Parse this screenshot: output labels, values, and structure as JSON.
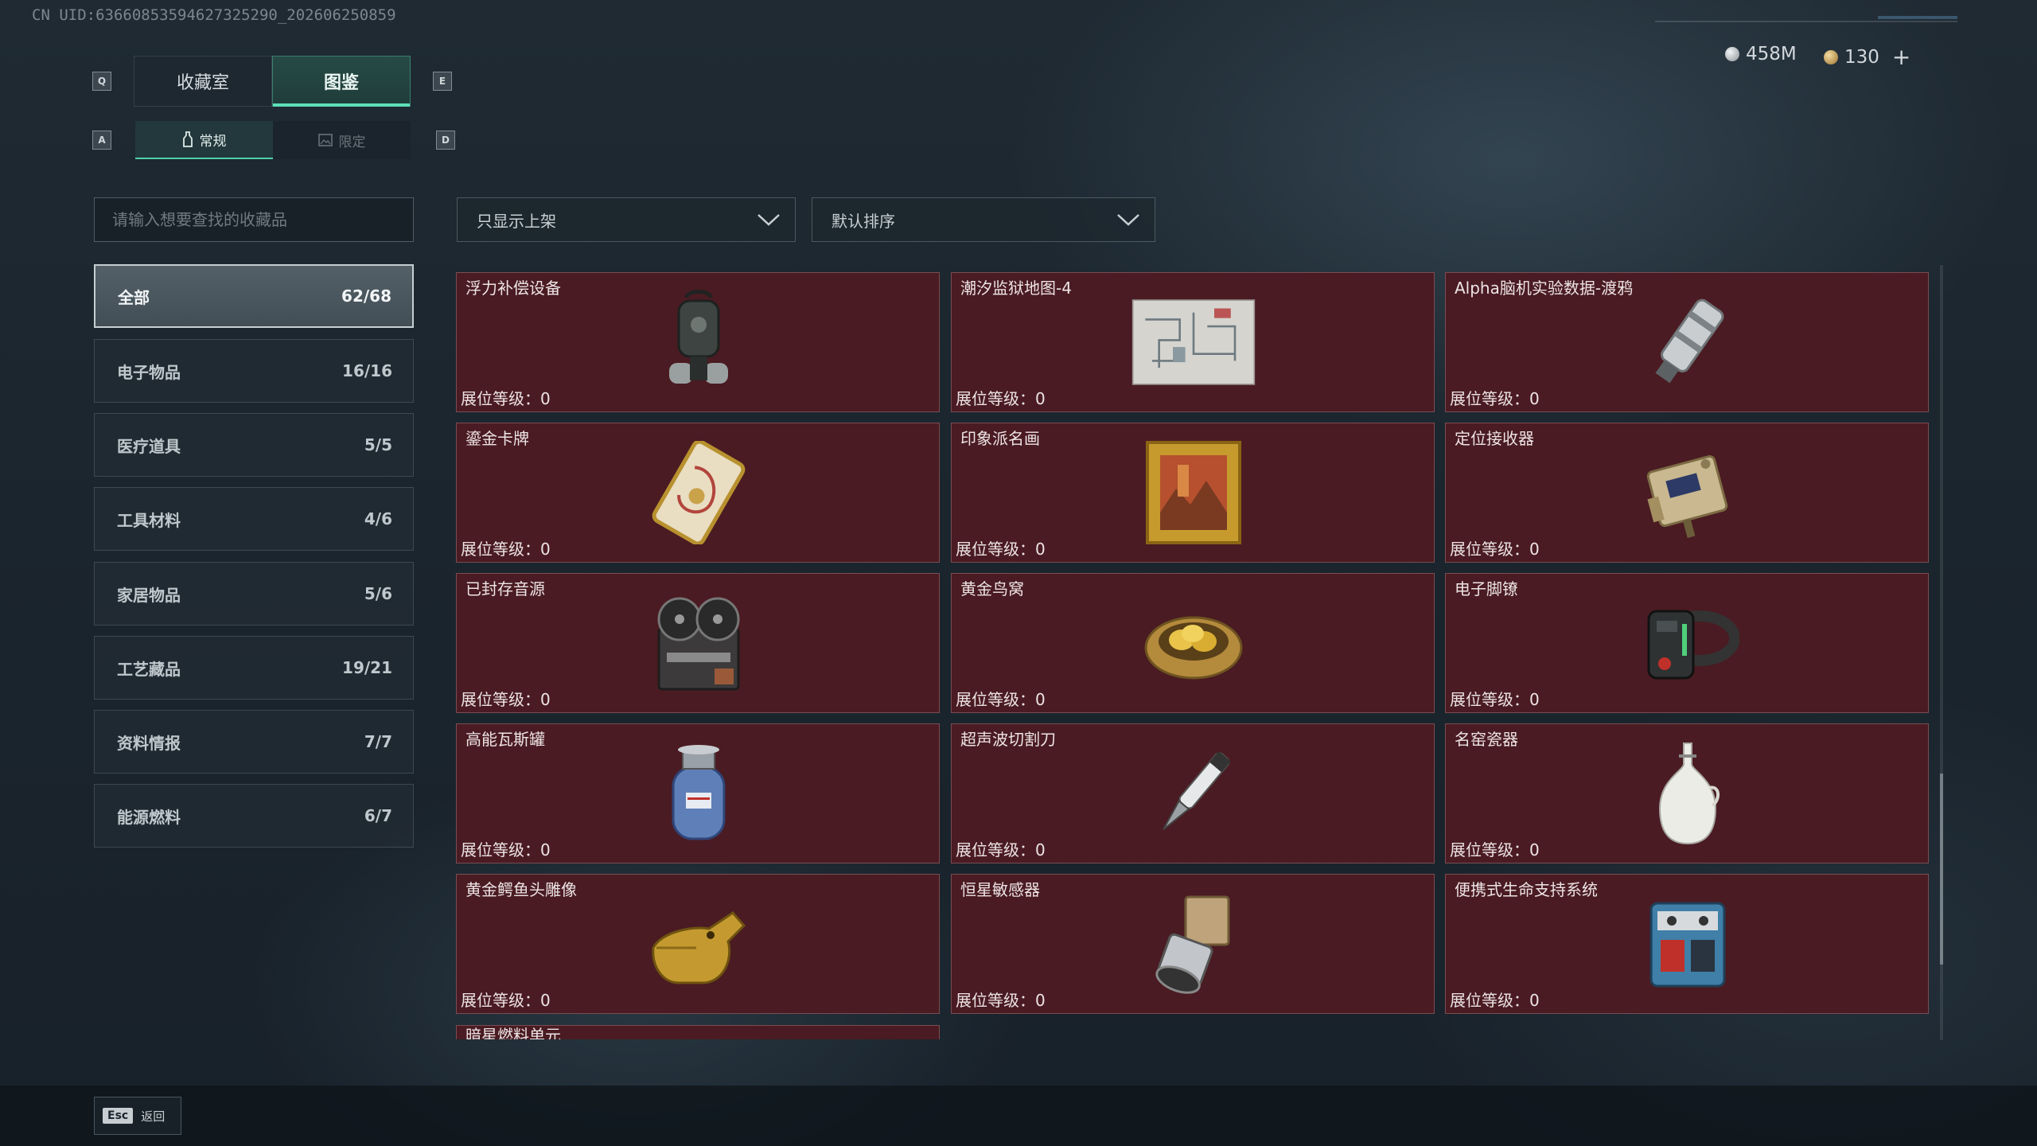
{
  "uid": "CN UID:636608535946273252​90_202606250859",
  "hotkeys": {
    "tab_left": "Q",
    "tab_right": "E",
    "sub_left": "A",
    "sub_right": "D"
  },
  "tabs": [
    {
      "label": "收藏室"
    },
    {
      "label": "图鉴"
    }
  ],
  "subtabs": [
    {
      "label": "常规"
    },
    {
      "label": "限定"
    }
  ],
  "currency": {
    "silver": "458M",
    "gold": "130"
  },
  "search": {
    "placeholder": "请输入想要查找的收藏品"
  },
  "filters": {
    "display": "只显示上架",
    "sort": "默认排序"
  },
  "categories": [
    {
      "label": "全部",
      "count": "62/68"
    },
    {
      "label": "电子物品",
      "count": "16/16"
    },
    {
      "label": "医疗道具",
      "count": "5/5"
    },
    {
      "label": "工具材料",
      "count": "4/6"
    },
    {
      "label": "家居物品",
      "count": "5/6"
    },
    {
      "label": "工艺藏品",
      "count": "19/21"
    },
    {
      "label": "资料情报",
      "count": "7/7"
    },
    {
      "label": "能源燃料",
      "count": "6/7"
    }
  ],
  "level_label": "展位等级：0",
  "items": [
    {
      "name": "浮力补偿设备",
      "icon": "buoyancy-device-icon"
    },
    {
      "name": "潮汐监狱地图-4",
      "icon": "map-icon"
    },
    {
      "name": "Alpha脑机实验数据-渡鸦",
      "icon": "data-canister-icon"
    },
    {
      "name": "鎏金卡牌",
      "icon": "gilded-card-icon"
    },
    {
      "name": "印象派名画",
      "icon": "painting-icon"
    },
    {
      "name": "定位接收器",
      "icon": "receiver-icon"
    },
    {
      "name": "已封存音源",
      "icon": "reel-recorder-icon"
    },
    {
      "name": "黄金鸟窝",
      "icon": "golden-nest-icon"
    },
    {
      "name": "电子脚镣",
      "icon": "ankle-monitor-icon"
    },
    {
      "name": "高能瓦斯罐",
      "icon": "gas-tank-icon"
    },
    {
      "name": "超声波切割刀",
      "icon": "ultrasonic-knife-icon"
    },
    {
      "name": "名窑瓷器",
      "icon": "porcelain-vase-icon"
    },
    {
      "name": "黄金鳄鱼头雕像",
      "icon": "crocodile-statue-icon"
    },
    {
      "name": "恒星敏感器",
      "icon": "star-sensor-icon"
    },
    {
      "name": "便携式生命支持系统",
      "icon": "life-support-icon"
    },
    {
      "name": "暗星燃料单元",
      "icon": ""
    }
  ],
  "esc": {
    "key": "Esc",
    "label": "返回"
  },
  "colors": {
    "card_bg": "#4a1b22",
    "accent": "#5ee0b8"
  }
}
